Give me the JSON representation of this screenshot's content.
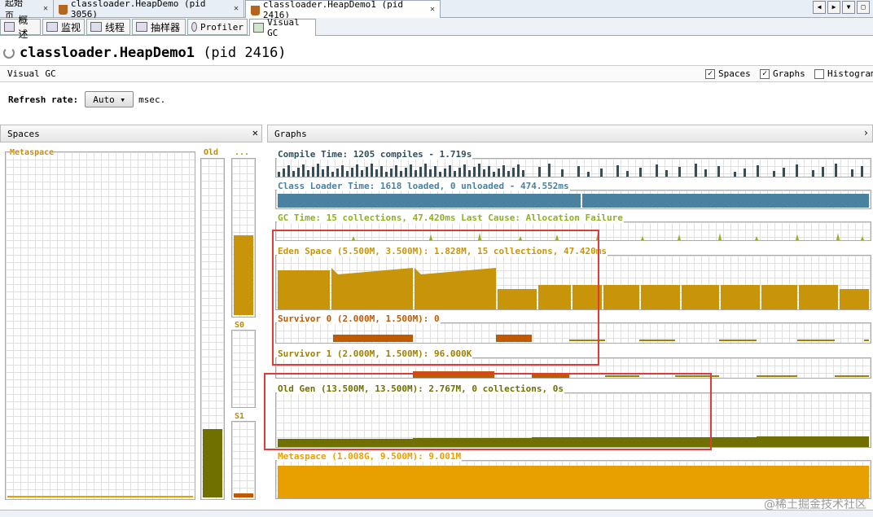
{
  "doc_tabs": [
    {
      "label": "起始页",
      "close": "✕"
    },
    {
      "label": "classloader.HeapDemo (pid 3056)",
      "close": "✕"
    },
    {
      "label": "classloader.HeapDemo1 (pid 2416)",
      "close": "✕"
    }
  ],
  "sub_tabs": [
    {
      "label": "概述",
      "icon": "overview-icon"
    },
    {
      "label": "监视",
      "icon": "monitor-icon"
    },
    {
      "label": "线程",
      "icon": "threads-icon"
    },
    {
      "label": "抽样器",
      "icon": "sampler-icon"
    },
    {
      "label": "Profiler",
      "icon": "profiler-icon"
    },
    {
      "label": "Visual GC",
      "icon": "visualgc-icon"
    }
  ],
  "page_title": {
    "main": "classloader.HeapDemo1",
    "pid": "(pid 2416)"
  },
  "visual_gc_label": "Visual GC",
  "options": {
    "spaces": {
      "label": "Spaces",
      "checked": "✓"
    },
    "graphs": {
      "label": "Graphs",
      "checked": "✓"
    },
    "histogram": {
      "label": "Histogram",
      "checked": ""
    }
  },
  "refresh": {
    "label": "Refresh rate:",
    "value": "Auto",
    "arrow": "▾",
    "unit": "msec."
  },
  "spaces_panel": {
    "title": "Spaces",
    "close": "✕",
    "metaspace": "Metaspace",
    "old": "Old",
    "eden": "...",
    "s0": "S0",
    "s1": "S1"
  },
  "graphs_panel": {
    "title": "Graphs",
    "close": "›",
    "compile": "Compile Time: 1205 compiles - 1.719s",
    "classloader": "Class Loader Time: 1618 loaded, 0 unloaded - 474.552ms",
    "gc": "GC Time: 15 collections, 47.420ms Last Cause: Allocation Failure",
    "eden": "Eden Space (5.500M, 3.500M): 1.828M, 15 collections, 47.420ms",
    "survivor0": "Survivor 0 (2.000M, 1.500M): 0",
    "survivor1": "Survivor 1 (2.000M, 1.500M): 96.000K",
    "oldgen": "Old Gen (13.500M, 13.500M): 2.767M, 0 collections, 0s",
    "metaspace": "Metaspace (1.008G, 9.500M): 9.001M"
  },
  "colors": {
    "compile": "#2f5060",
    "classloader": "#4a80a0",
    "gc": "#8fb020",
    "eden": "#c8940a",
    "survivor0": "#c05a00",
    "survivor1": "#a08000",
    "oldgen": "#707000",
    "metaspace": "#e8a000",
    "highlight": "#e03a3a"
  },
  "nav_buttons": [
    "◀",
    "▶",
    "▼",
    "□"
  ],
  "watermark": "@稀土掘金技术社区"
}
